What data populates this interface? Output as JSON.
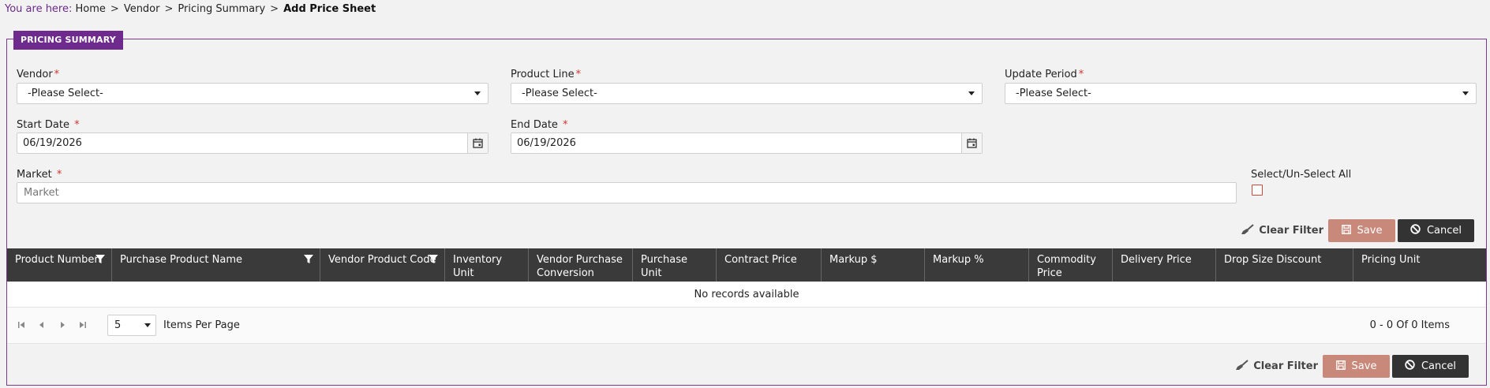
{
  "breadcrumb": {
    "prefix": "You are here:",
    "items": [
      "Home",
      "Vendor",
      "Pricing Summary"
    ],
    "current": "Add Price Sheet",
    "separator": ">"
  },
  "panel": {
    "title": "PRICING SUMMARY"
  },
  "form": {
    "vendor": {
      "label": "Vendor",
      "value": "-Please Select-"
    },
    "product_line": {
      "label": "Product Line",
      "value": "-Please Select-"
    },
    "update_period": {
      "label": "Update Period",
      "value": "-Please Select-"
    },
    "start_date": {
      "label": "Start Date ",
      "value": "06/19/2026"
    },
    "end_date": {
      "label": "End Date ",
      "value": "06/19/2026"
    },
    "market": {
      "label": "Market ",
      "placeholder": "Market"
    },
    "select_all": {
      "label": "Select/Un-Select All"
    },
    "required_mark": "*"
  },
  "toolbar": {
    "clear_filter": "Clear Filter",
    "save": "Save",
    "cancel": "Cancel"
  },
  "grid": {
    "columns": [
      "Product Number",
      "Purchase Product Name",
      "Vendor Product Code",
      "Inventory Unit",
      "Vendor Purchase Conversion",
      "Purchase Unit",
      "Contract Price",
      "Markup $",
      "Markup %",
      "Commodity Price",
      "Delivery Price",
      "Drop Size Discount",
      "Pricing Unit"
    ],
    "empty_message": "No records available",
    "page_size": "5",
    "items_per_page": "Items Per Page",
    "items_count": "0 - 0 Of 0 Items"
  },
  "colors": {
    "accent": "#6f2a8e",
    "header_bg": "#3a3a3a",
    "save_bg": "#c8887a",
    "cancel_bg": "#333333",
    "required": "#d0342c"
  }
}
